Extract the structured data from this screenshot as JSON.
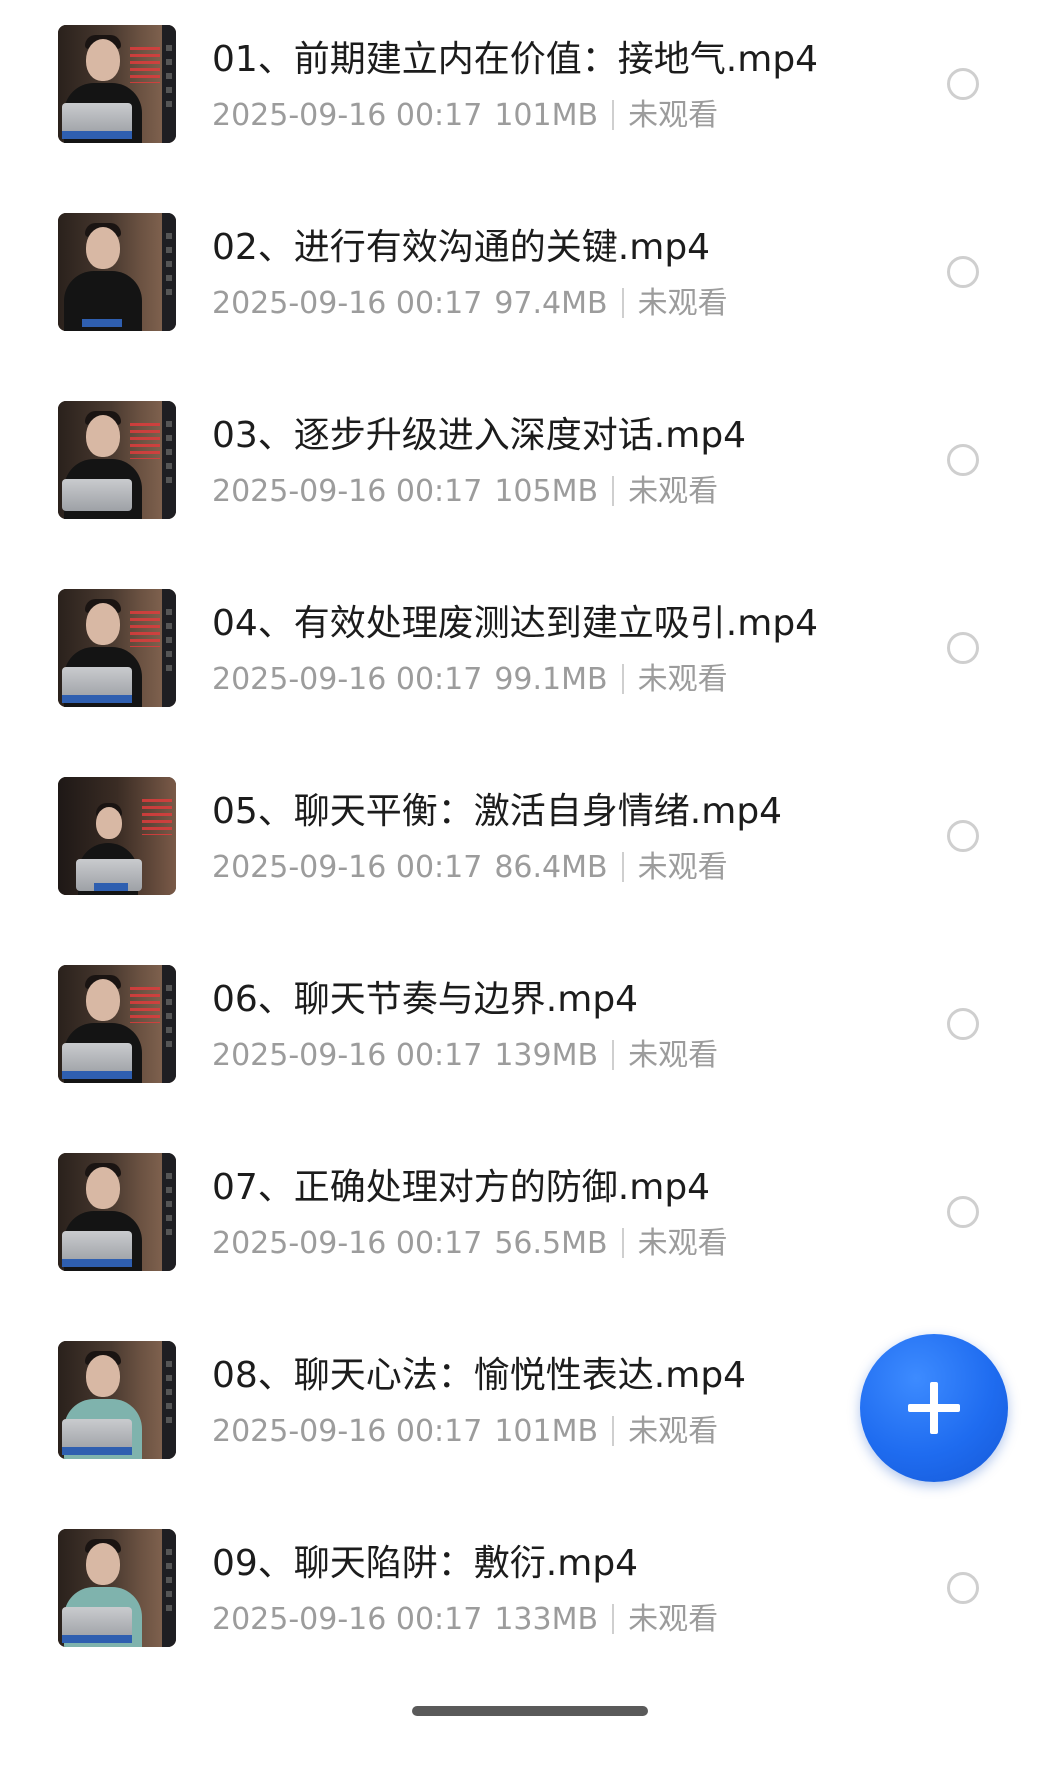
{
  "files": [
    {
      "title": "01、前期建立内在价值：接地气.mp4",
      "datetime": "2025-09-16 00:17",
      "size": "101MB",
      "status": "未观看"
    },
    {
      "title": "02、进行有效沟通的关键.mp4",
      "datetime": "2025-09-16 00:17",
      "size": "97.4MB",
      "status": "未观看"
    },
    {
      "title": "03、逐步升级进入深度对话.mp4",
      "datetime": "2025-09-16 00:17",
      "size": "105MB",
      "status": "未观看"
    },
    {
      "title": "04、有效处理废测达到建立吸引.mp4",
      "datetime": "2025-09-16 00:17",
      "size": "99.1MB",
      "status": "未观看"
    },
    {
      "title": "05、聊天平衡：激活自身情绪.mp4",
      "datetime": "2025-09-16 00:17",
      "size": "86.4MB",
      "status": "未观看"
    },
    {
      "title": "06、聊天节奏与边界.mp4",
      "datetime": "2025-09-16 00:17",
      "size": "139MB",
      "status": "未观看"
    },
    {
      "title": "07、正确处理对方的防御.mp4",
      "datetime": "2025-09-16 00:17",
      "size": "56.5MB",
      "status": "未观看"
    },
    {
      "title": "08、聊天心法：愉悦性表达.mp4",
      "datetime": "2025-09-16 00:17",
      "size": "101MB",
      "status": "未观看"
    },
    {
      "title": "09、聊天陷阱：敷衍.mp4",
      "datetime": "2025-09-16 00:17",
      "size": "133MB",
      "status": "未观看"
    }
  ],
  "fab": {
    "icon": "plus-icon",
    "color": "#1f6cf0"
  },
  "colors": {
    "title": "#1c1c1c",
    "meta": "#9c9c9c",
    "radio_border": "#cfcfcf"
  }
}
